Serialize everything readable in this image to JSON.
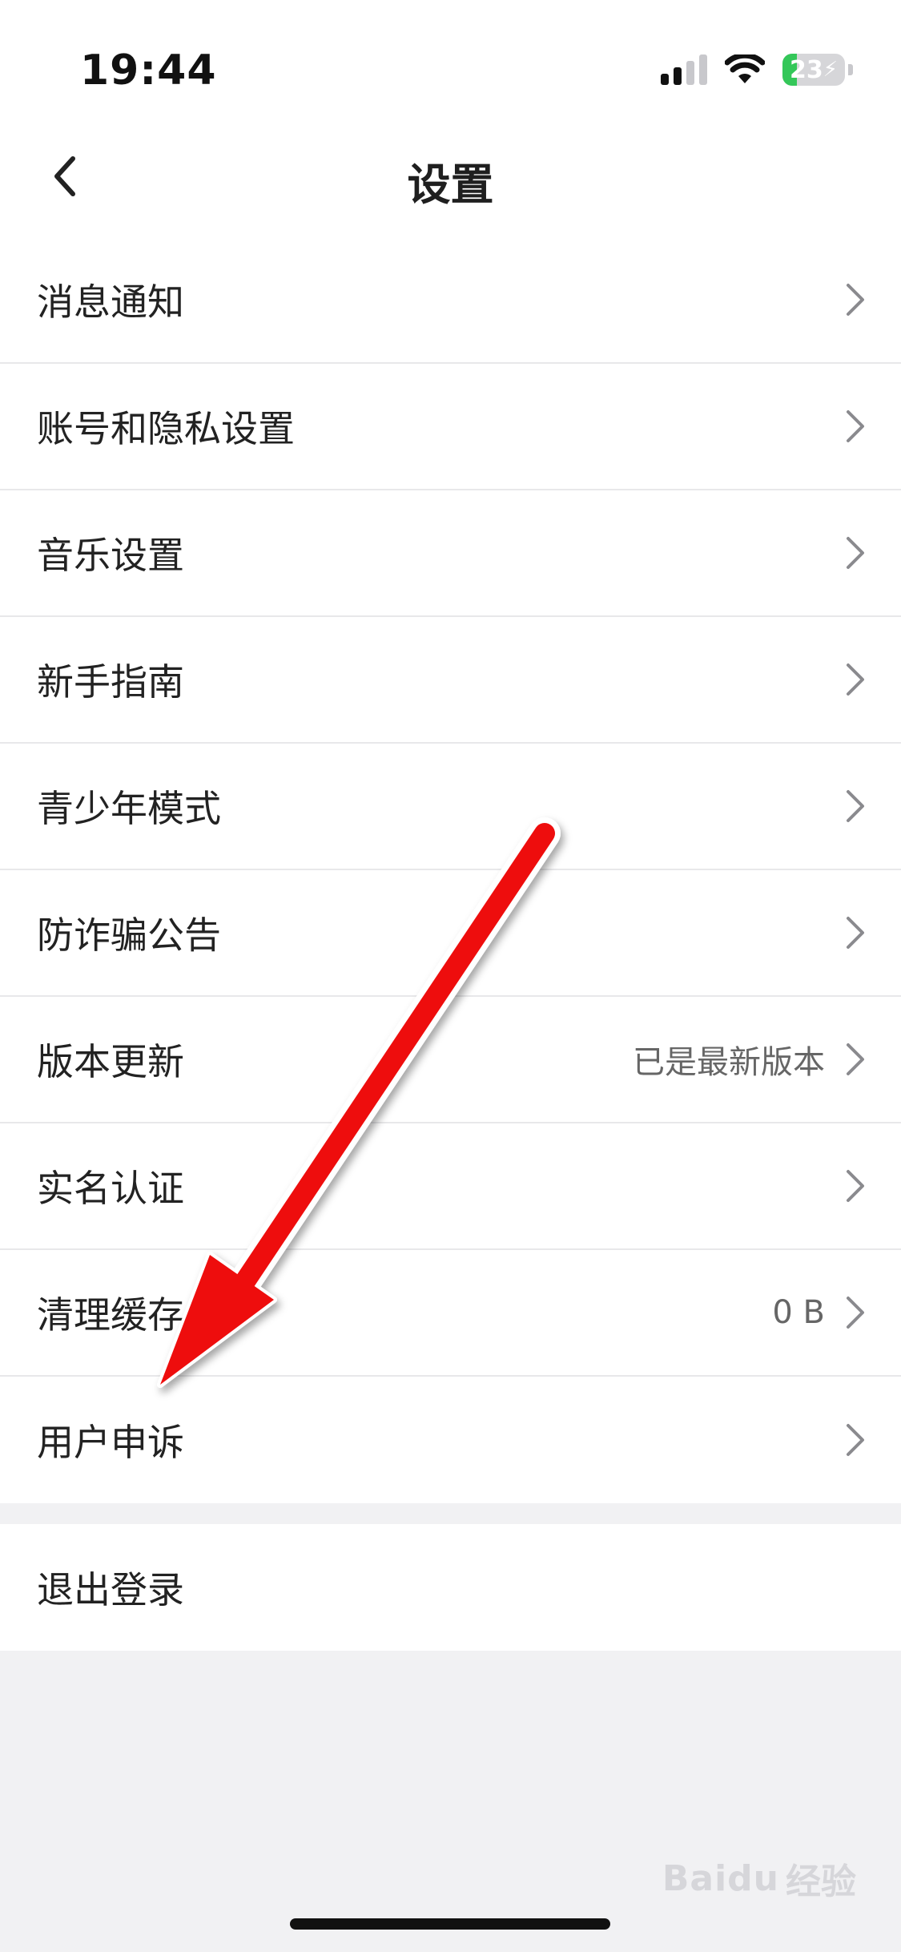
{
  "status_bar": {
    "time": "19:44",
    "battery_level": "23",
    "battery_fraction": 0.23
  },
  "nav": {
    "title": "设置"
  },
  "settings_items": [
    {
      "label": "消息通知",
      "value": ""
    },
    {
      "label": "账号和隐私设置",
      "value": ""
    },
    {
      "label": "音乐设置",
      "value": ""
    },
    {
      "label": "新手指南",
      "value": ""
    },
    {
      "label": "青少年模式",
      "value": ""
    },
    {
      "label": "防诈骗公告",
      "value": ""
    },
    {
      "label": "版本更新",
      "value": "已是最新版本"
    },
    {
      "label": "实名认证",
      "value": ""
    },
    {
      "label": "清理缓存",
      "value": "0 B"
    },
    {
      "label": "用户申诉",
      "value": ""
    }
  ],
  "logout": {
    "label": "退出登录"
  },
  "watermark": {
    "brand": "Baidu",
    "sub": "经验"
  },
  "colors": {
    "annotation_arrow": "#ee1111",
    "battery_green": "#34c759",
    "background": "#f1f1f3"
  }
}
